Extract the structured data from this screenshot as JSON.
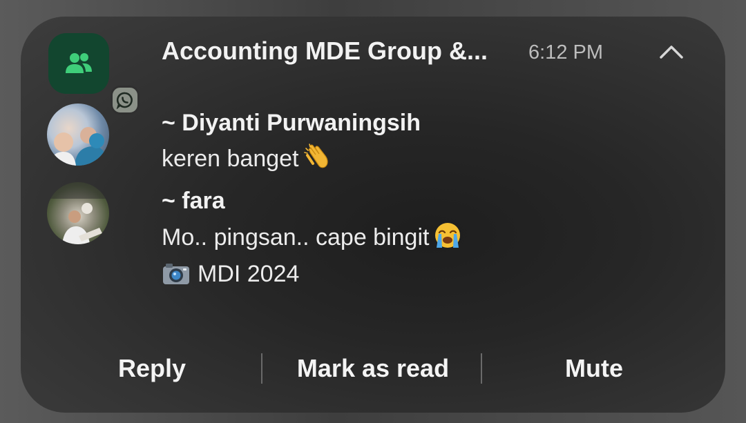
{
  "notification": {
    "group_title": "Accounting MDE Group &...",
    "time": "6:12 PM",
    "app_icon": "group-chat-icon",
    "badge_icon": "whatsapp-icon",
    "collapse_icon": "chevron-up-icon",
    "accent_color": "#12462f"
  },
  "messages": [
    {
      "sender": "~ Diyanti Purwaningsih",
      "text": "keren banget",
      "emoji": "clapping-hands-emoji"
    },
    {
      "sender": "~ fara",
      "text": "Mo.. pingsan.. cape bingit",
      "emoji": "crying-face-emoji",
      "attachment_icon": "camera-emoji",
      "attachment_text": "MDI 2024"
    }
  ],
  "actions": {
    "reply": "Reply",
    "mark_as_read": "Mark as read",
    "mute": "Mute"
  }
}
